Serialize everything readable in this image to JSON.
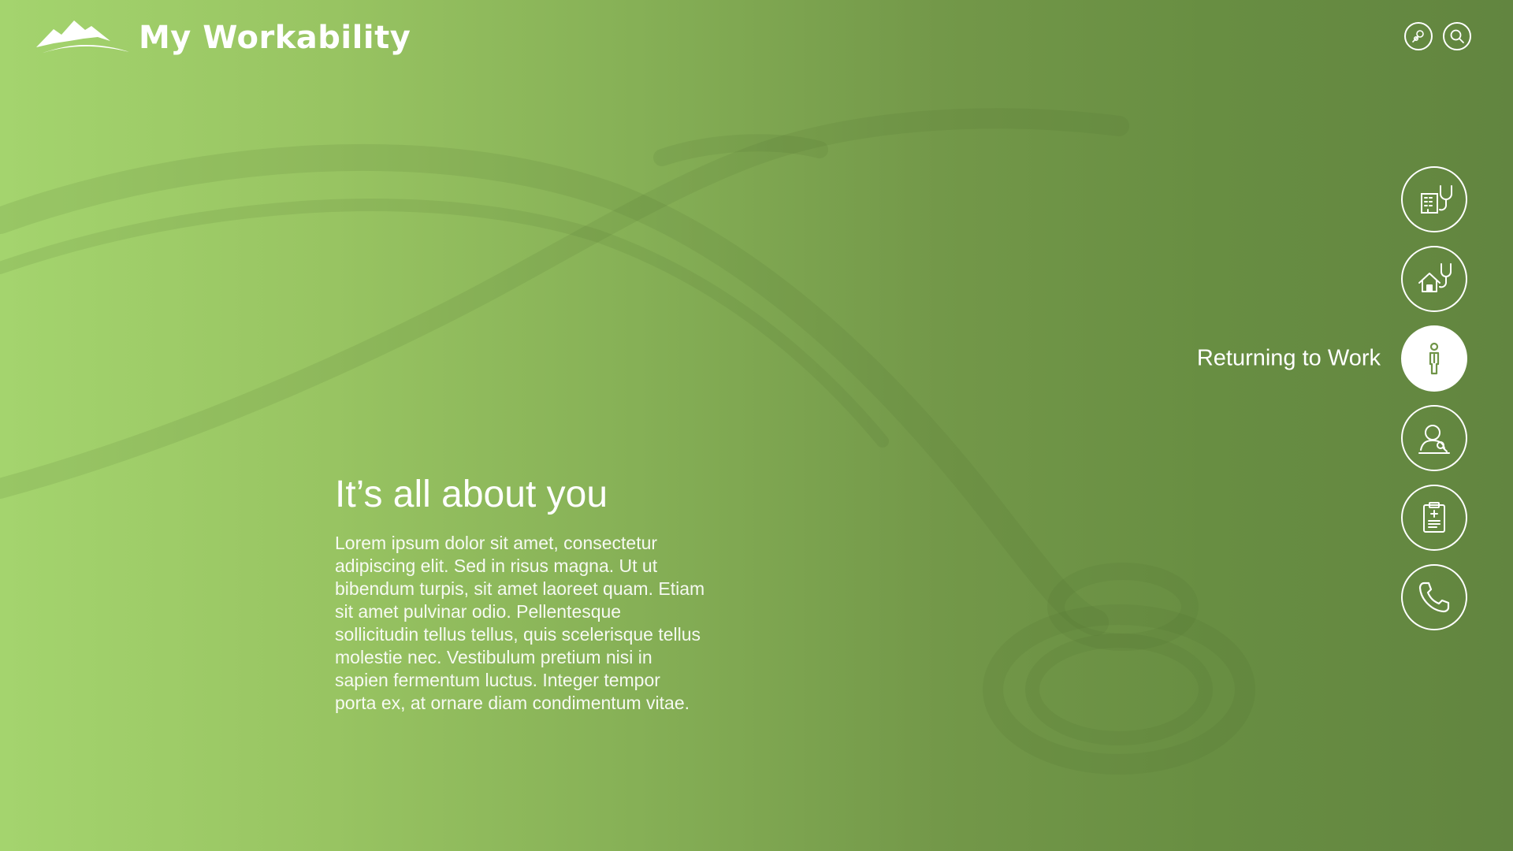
{
  "header": {
    "brand": "My Workability",
    "logo_icon": "mountain-logo-icon",
    "icons": [
      "user-search-icon",
      "search-icon"
    ]
  },
  "hero": {
    "title": "It’s all about you",
    "body": "Lorem ipsum dolor sit amet, consectetur adipiscing elit. Sed in risus magna. Ut ut bibendum turpis, sit amet laoreet quam. Etiam sit amet pulvinar odio. Pellentesque sollicitudin tellus tellus, quis scelerisque tellus molestie nec. Vestibulum pretium nisi in sapien fermentum luctus. Integer tempor porta ex, at ornare diam condimentum vitae."
  },
  "side_nav": {
    "items": [
      {
        "icon": "hospital-stethoscope-icon",
        "label": ""
      },
      {
        "icon": "home-stethoscope-icon",
        "label": ""
      },
      {
        "icon": "worker-icon",
        "label": "Returning to Work",
        "active": true
      },
      {
        "icon": "person-search-icon",
        "label": ""
      },
      {
        "icon": "clipboard-medical-icon",
        "label": ""
      },
      {
        "icon": "phone-icon",
        "label": ""
      }
    ]
  },
  "colors": {
    "gradient_left": "#a4d46e",
    "gradient_right": "#628540",
    "foreground": "#ffffff",
    "active_icon": "#6f9447"
  }
}
